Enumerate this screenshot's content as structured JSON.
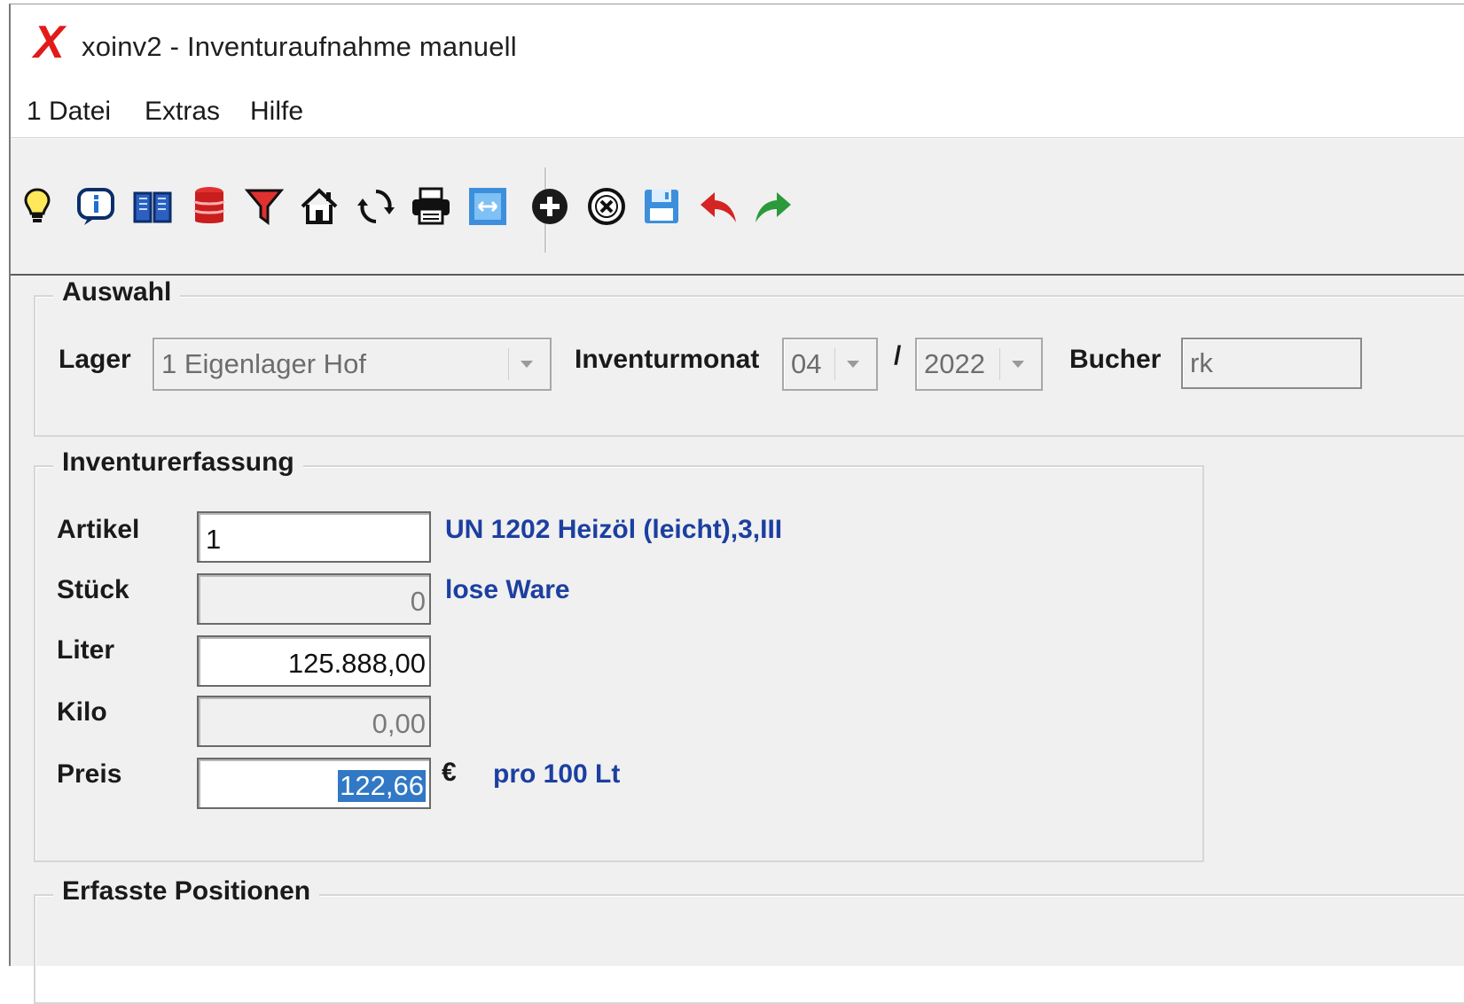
{
  "window": {
    "title": "xoinv2 - Inventuraufnahme manuell",
    "logo": "X"
  },
  "menu": {
    "items": [
      "1 Datei",
      "Extras",
      "Hilfe"
    ]
  },
  "toolbar": {
    "icons": [
      "lightbulb-icon",
      "info-icon",
      "book-icon",
      "database-icon",
      "filter-icon",
      "home-icon",
      "refresh-icon",
      "printer-icon",
      "resize-icon",
      "add-icon",
      "cancel-icon",
      "save-icon",
      "undo-icon",
      "redo-icon"
    ]
  },
  "auswahl": {
    "title": "Auswahl",
    "lager_label": "Lager",
    "lager_value": "1  Eigenlager Hof",
    "monat_label": "Inventurmonat",
    "monat_value": "04",
    "slash": "/",
    "jahr_value": "2022",
    "bucher_label": "Bucher",
    "bucher_value": "rk"
  },
  "erfassung": {
    "title": "Inventurerfassung",
    "artikel_label": "Artikel",
    "artikel_value": "1",
    "artikel_desc": "UN 1202 Heizöl (leicht),3,III",
    "stueck_label": "Stück",
    "stueck_value": "0",
    "stueck_desc": "lose Ware",
    "liter_label": "Liter",
    "liter_value": "125.888,00",
    "kilo_label": "Kilo",
    "kilo_value": "0,00",
    "preis_label": "Preis",
    "preis_value": "122,66",
    "currency": "€",
    "preis_unit": "pro 100 Lt"
  },
  "positionen": {
    "title": "Erfasste Positionen"
  },
  "colors": {
    "accent_blue": "#1c3fa0",
    "logo_red": "#e21a1a",
    "selection": "#3178c6"
  }
}
